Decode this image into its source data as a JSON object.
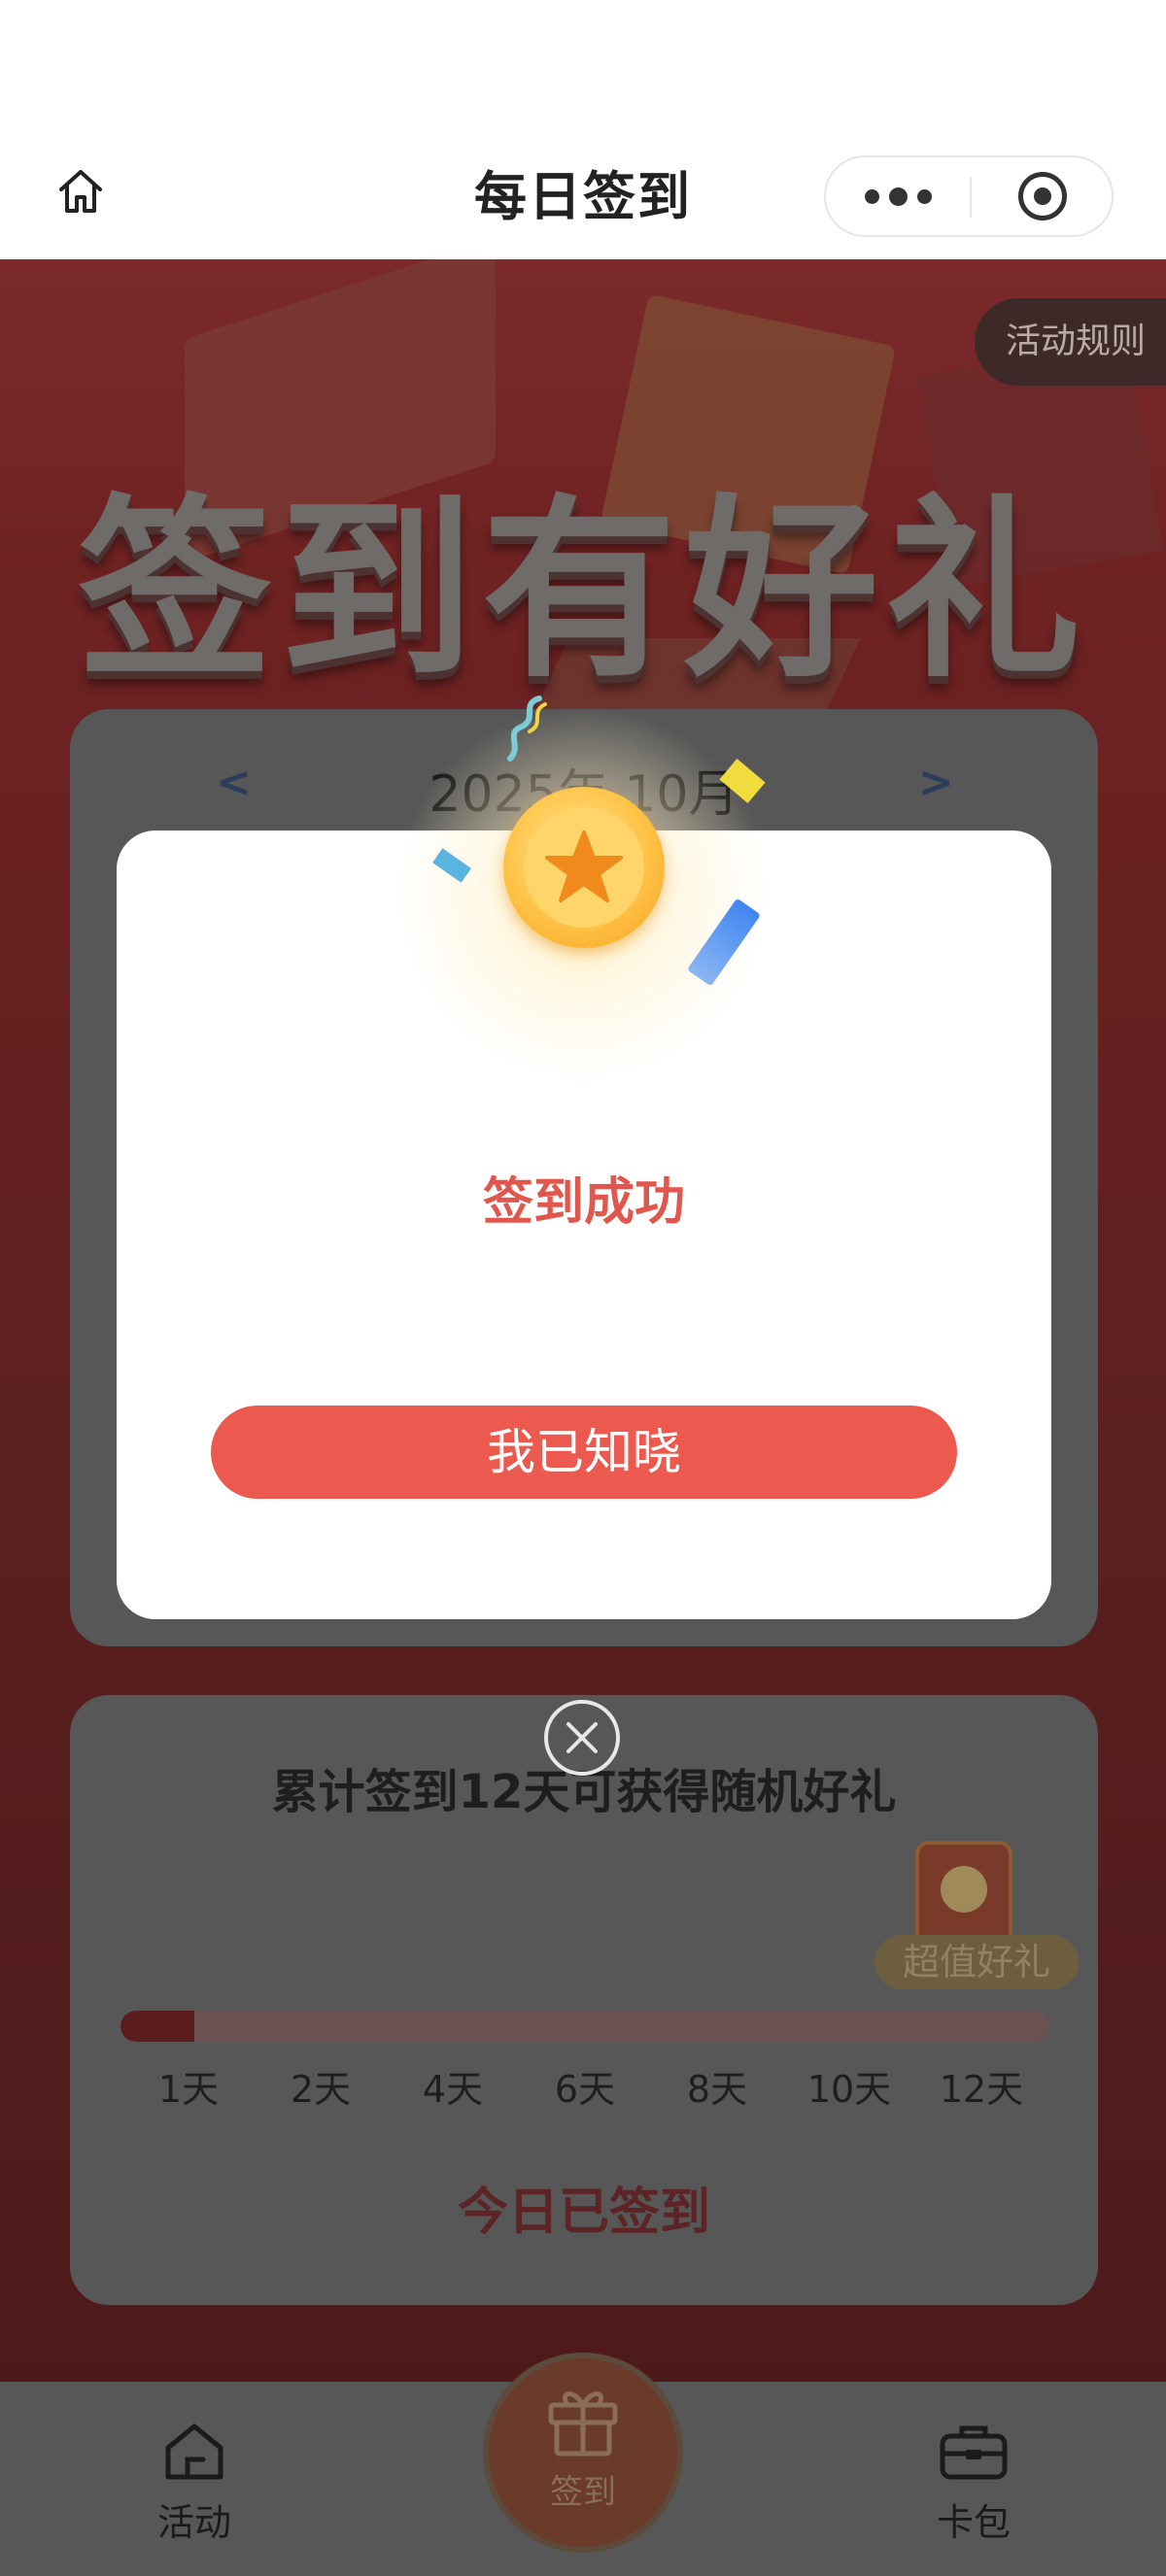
{
  "header": {
    "title": "每日签到",
    "home_icon": "home-icon",
    "more_icon": "more-dots-icon",
    "close_icon": "target-icon"
  },
  "hero": {
    "rules_label": "活动规则",
    "banner_title": "签到有好礼"
  },
  "calendar": {
    "prev": "<",
    "month": "2025年 10月",
    "next": ">"
  },
  "progress": {
    "title": "累计签到12天可获得随机好礼",
    "gift_badge": "超值好礼",
    "current_days": 1,
    "target_days": 12,
    "fill_fraction": 0.08,
    "milestones": [
      "1天",
      "2天",
      "4天",
      "6天",
      "8天",
      "10天",
      "12天"
    ],
    "status": "今日已签到"
  },
  "tabbar": {
    "items": [
      {
        "label": "活动",
        "icon": "home-icon"
      },
      {
        "label": "签到",
        "icon": "gift-icon"
      },
      {
        "label": "卡包",
        "icon": "wallet-icon"
      }
    ]
  },
  "modal": {
    "title": "签到成功",
    "button": "我已知晓",
    "close_icon": "close-icon",
    "medal_icon": "star-medal-icon"
  },
  "colors": {
    "accent": "#ec5a4f",
    "title_red": "#e2574d",
    "medal": "#ffc247",
    "overlay": "#575757"
  }
}
